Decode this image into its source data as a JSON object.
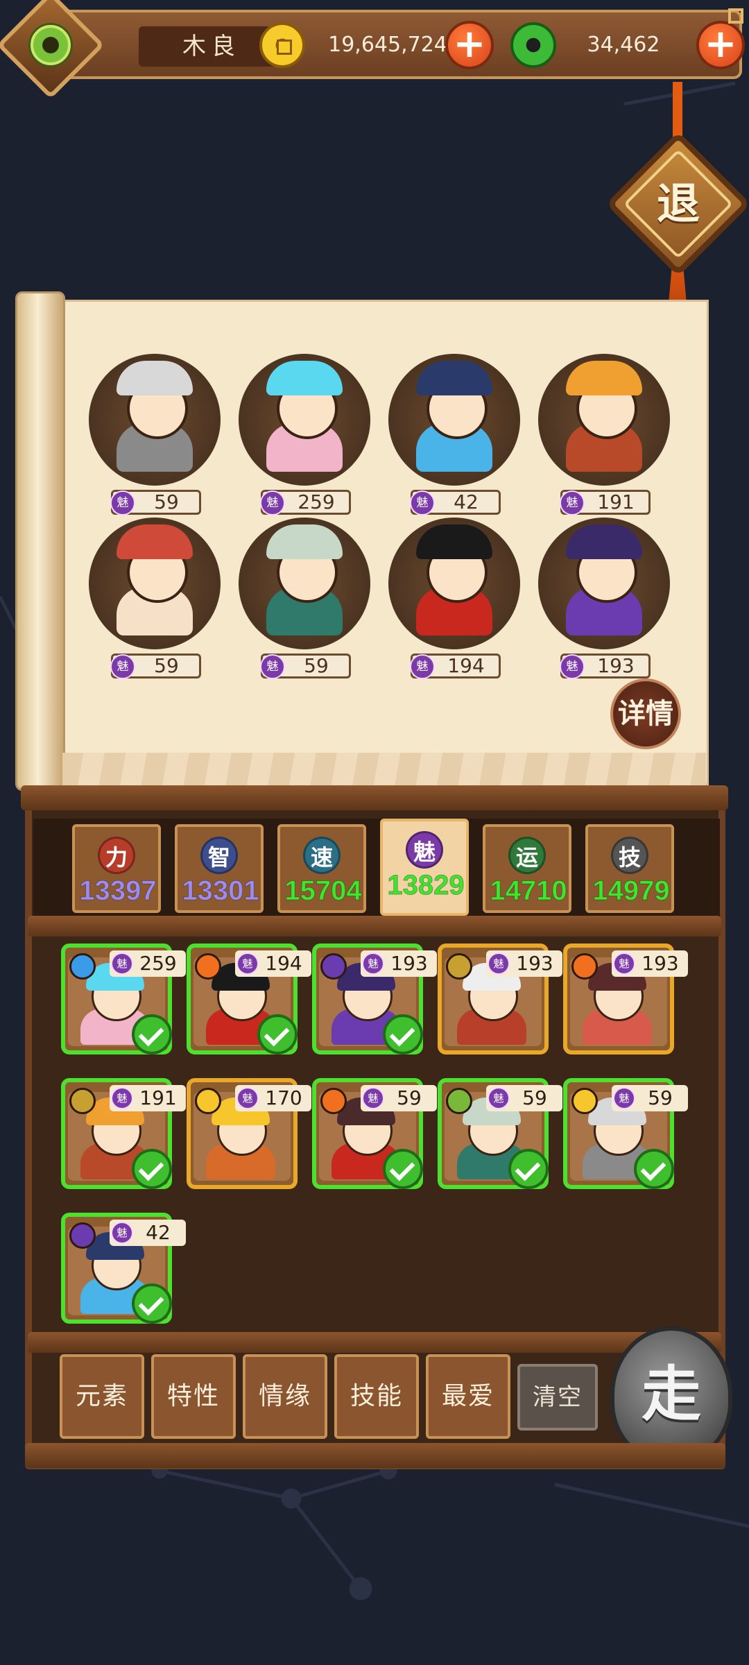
{
  "topbar": {
    "player_name": "木良",
    "gold_amount": "19,645,724",
    "jade_amount": "34,462"
  },
  "exit_label": "退",
  "details_label": "详情",
  "charm_label": "魅",
  "team": [
    {
      "charm": "59"
    },
    {
      "charm": "259"
    },
    {
      "charm": "42"
    },
    {
      "charm": "191"
    },
    {
      "charm": "59"
    },
    {
      "charm": "59"
    },
    {
      "charm": "194"
    },
    {
      "charm": "193"
    }
  ],
  "attributes": [
    {
      "name": "力",
      "value": "13397",
      "icon_color": "#b83c2a",
      "value_color": "#9d8bf0"
    },
    {
      "name": "智",
      "value": "13301",
      "icon_color": "#3d4e8f",
      "value_color": "#9d8bf0"
    },
    {
      "name": "速",
      "value": "15704",
      "icon_color": "#2a6f86",
      "value_color": "#3ee62e"
    },
    {
      "name": "魅",
      "value": "13829",
      "icon_color": "#7c3aa8",
      "value_color": "#3ee62e",
      "active": true
    },
    {
      "name": "运",
      "value": "14710",
      "icon_color": "#2f7a3a",
      "value_color": "#3ee62e"
    },
    {
      "name": "技",
      "value": "14979",
      "icon_color": "#555555",
      "value_color": "#3ee62e"
    }
  ],
  "roster": [
    {
      "charm": "259",
      "selected": true,
      "element": "water-icon",
      "element_color": "#3a9be8"
    },
    {
      "charm": "194",
      "selected": true,
      "element": "fire-icon",
      "element_color": "#f07020"
    },
    {
      "charm": "193",
      "selected": true,
      "element": "moon-icon",
      "element_color": "#6a3cb0"
    },
    {
      "charm": "193",
      "selected": false,
      "element": "earth-icon",
      "element_color": "#c6a030"
    },
    {
      "charm": "193",
      "selected": false,
      "element": "fire-icon",
      "element_color": "#f07020"
    },
    {
      "charm": "191",
      "selected": true,
      "element": "earth-icon",
      "element_color": "#c6a030"
    },
    {
      "charm": "170",
      "selected": false,
      "element": "sun-icon",
      "element_color": "#f6c62c"
    },
    {
      "charm": "59",
      "selected": true,
      "element": "fire-icon",
      "element_color": "#f07020"
    },
    {
      "charm": "59",
      "selected": true,
      "element": "leaf-icon",
      "element_color": "#7ab83a"
    },
    {
      "charm": "59",
      "selected": true,
      "element": "sun-icon",
      "element_color": "#f6c62c"
    },
    {
      "charm": "42",
      "selected": true,
      "element": "moon-icon",
      "element_color": "#6a3cb0"
    }
  ],
  "filters": [
    "元素",
    "特性",
    "情缘",
    "技能",
    "最爱"
  ],
  "clear_label": "清空",
  "go_label": "走"
}
